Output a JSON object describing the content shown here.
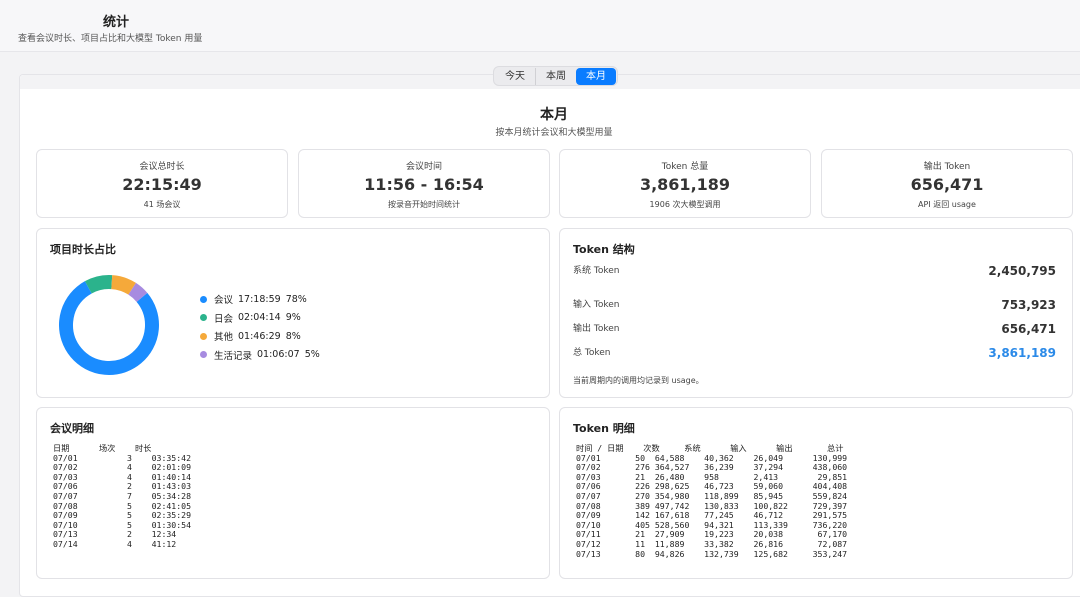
{
  "header": {
    "title": "统计",
    "subtitle": "查看会议时长、项目占比和大模型 Token 用量"
  },
  "period_tabs": [
    {
      "label": "今天",
      "active": false
    },
    {
      "label": "本周",
      "active": false
    },
    {
      "label": "本月",
      "active": true
    }
  ],
  "period": {
    "title": "本月",
    "subtitle": "按本月统计会议和大模型用量"
  },
  "stats": [
    {
      "label": "会议总时长",
      "value": "22:15:49",
      "note": "41 场会议"
    },
    {
      "label": "会议时间",
      "value": "11:56 - 16:54",
      "note": "按录音开始时间统计"
    },
    {
      "label": "Token 总量",
      "value": "3,861,189",
      "note": "1906 次大模型调用"
    },
    {
      "label": "输出 Token",
      "value": "656,471",
      "note": "API 返回 usage"
    }
  ],
  "project_share": {
    "title": "项目时长占比",
    "items": [
      {
        "name": "会议",
        "duration": "17:18:59",
        "percent_label": "78%",
        "percent": 78,
        "color": "#1a8cff"
      },
      {
        "name": "日会",
        "duration": "02:04:14",
        "percent_label": "9%",
        "percent": 9,
        "color": "#2bb38c"
      },
      {
        "name": "其他",
        "duration": "01:46:29",
        "percent_label": "8%",
        "percent": 8,
        "color": "#f5a93a"
      },
      {
        "name": "生活记录",
        "duration": "01:06:07",
        "percent_label": "5%",
        "percent": 5,
        "color": "#a78be0"
      }
    ]
  },
  "token_structure": {
    "title": "Token 结构",
    "rows": [
      {
        "label": "系统 Token",
        "value": "2,450,795"
      },
      {
        "label": "输入 Token",
        "value": "753,923"
      },
      {
        "label": "输出 Token",
        "value": "656,471"
      },
      {
        "label": "总 Token",
        "value": "3,861,189"
      }
    ],
    "footnote": "当前周期内的调用均记录到 usage。"
  },
  "meeting_detail": {
    "title": "会议明细",
    "headers": [
      "日期",
      "场次",
      "时长"
    ],
    "rows": [
      [
        "07/01",
        "3",
        "03:35:42"
      ],
      [
        "07/02",
        "4",
        "02:01:09"
      ],
      [
        "07/03",
        "4",
        "01:40:14"
      ],
      [
        "07/06",
        "2",
        "01:43:03"
      ],
      [
        "07/07",
        "7",
        "05:34:28"
      ],
      [
        "07/08",
        "5",
        "02:41:05"
      ],
      [
        "07/09",
        "5",
        "02:35:29"
      ],
      [
        "07/10",
        "5",
        "01:30:54"
      ],
      [
        "07/13",
        "2",
        "12:34"
      ],
      [
        "07/14",
        "4",
        "41:12"
      ]
    ]
  },
  "token_detail": {
    "title": "Token 明细",
    "headers": [
      "时间 / 日期",
      "次数",
      "系统",
      "输入",
      "输出",
      "总计"
    ],
    "rows": [
      [
        "07/01",
        "50",
        "64,588",
        "40,362",
        "26,049",
        "130,999"
      ],
      [
        "07/02",
        "276",
        "364,527",
        "36,239",
        "37,294",
        "438,060"
      ],
      [
        "07/03",
        "21",
        "26,480",
        "958",
        "2,413",
        "29,851"
      ],
      [
        "07/06",
        "226",
        "298,625",
        "46,723",
        "59,060",
        "404,408"
      ],
      [
        "07/07",
        "270",
        "354,980",
        "118,899",
        "85,945",
        "559,824"
      ],
      [
        "07/08",
        "389",
        "497,742",
        "130,833",
        "100,822",
        "729,397"
      ],
      [
        "07/09",
        "142",
        "167,618",
        "77,245",
        "46,712",
        "291,575"
      ],
      [
        "07/10",
        "405",
        "528,560",
        "94,321",
        "113,339",
        "736,220"
      ],
      [
        "07/11",
        "21",
        "27,909",
        "19,223",
        "20,038",
        "67,170"
      ],
      [
        "07/12",
        "11",
        "11,889",
        "33,382",
        "26,816",
        "72,087"
      ],
      [
        "07/13",
        "80",
        "94,826",
        "132,739",
        "125,682",
        "353,247"
      ]
    ]
  }
}
